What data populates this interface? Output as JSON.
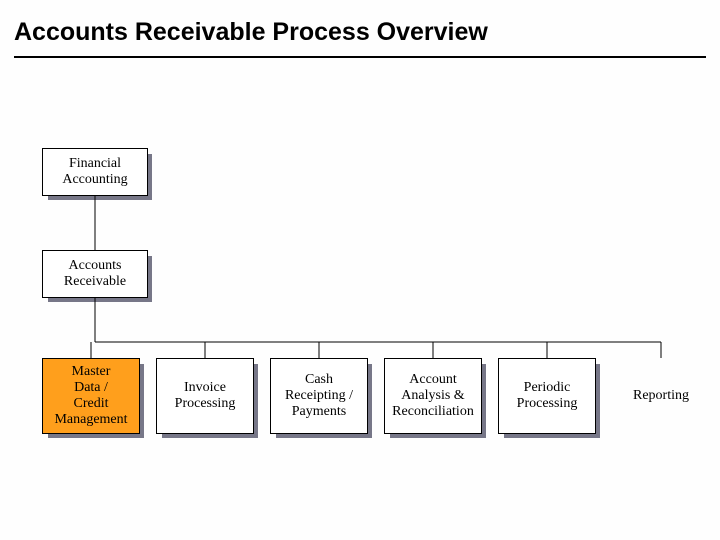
{
  "title": "Accounts Receivable Process Overview",
  "level0": {
    "label": "Financial\nAccounting"
  },
  "level1": {
    "label": "Accounts\nReceivable"
  },
  "level2": [
    {
      "key": "md",
      "label": "Master\nData /\nCredit\nManagement",
      "highlight": true
    },
    {
      "key": "ip",
      "label": "Invoice\nProcessing",
      "highlight": false
    },
    {
      "key": "cr",
      "label": "Cash\nReceipting /\nPayments",
      "highlight": false
    },
    {
      "key": "aa",
      "label": "Account\nAnalysis &\nReconciliation",
      "highlight": false
    },
    {
      "key": "pp",
      "label": "Periodic\nProcessing",
      "highlight": false
    },
    {
      "key": "rp",
      "label": "Reporting",
      "highlight": false
    }
  ]
}
